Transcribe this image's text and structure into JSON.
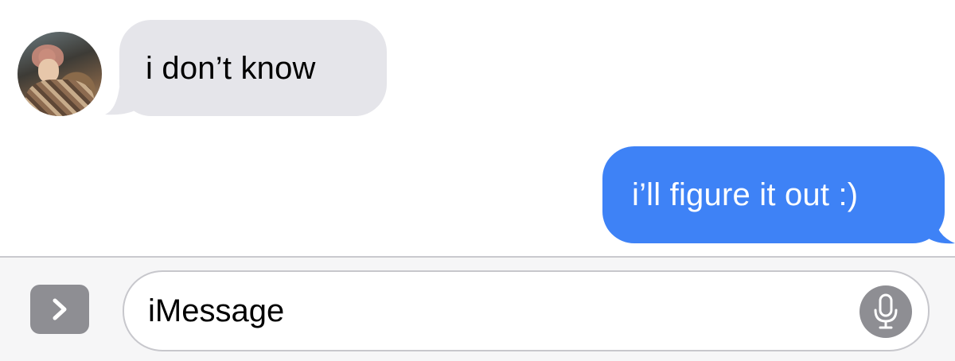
{
  "thread": {
    "incoming": {
      "text": "i don’t know"
    },
    "outgoing": {
      "text": "i’ll figure it out :)"
    }
  },
  "composer": {
    "input_text": "iMessage"
  },
  "icons": {
    "apps": "chevron-right-icon",
    "dictation": "microphone-icon",
    "avatar": "contact-photo"
  },
  "colors": {
    "incoming_bubble": "#e5e5ea",
    "outgoing_bubble": "#3e82f6",
    "composer_background": "#f6f6f7",
    "icon_gray": "#8e8e93"
  }
}
